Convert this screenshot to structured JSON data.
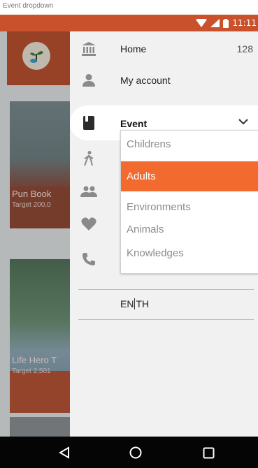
{
  "caption": "Event dropdown",
  "status_bar": {
    "time": "11:11",
    "color": "#c9522d"
  },
  "background": {
    "cards": [
      {
        "title": "Pun Book",
        "subtitle": "Target 200,0"
      },
      {
        "title": "Life Hero T",
        "subtitle": "Target 2,501"
      }
    ]
  },
  "drawer": {
    "items": [
      {
        "label": "Home",
        "badge": "128",
        "icon": "bank-icon"
      },
      {
        "label": "My account",
        "icon": "person-icon"
      },
      {
        "label": "Event",
        "icon": "book-icon"
      }
    ],
    "hidden_icons": [
      "walk-icon",
      "group-icon",
      "heart-icon",
      "phone-icon"
    ],
    "dropdown": {
      "options": [
        "Childrens",
        "Adults",
        "Environments",
        "Animals",
        "Knowledges"
      ],
      "selected": "Adults",
      "accent": "#f26a2d"
    },
    "language": {
      "left": "EN",
      "right": "TH"
    }
  },
  "nav_bar": {
    "buttons": [
      "back-icon",
      "home-icon",
      "recents-icon"
    ]
  }
}
